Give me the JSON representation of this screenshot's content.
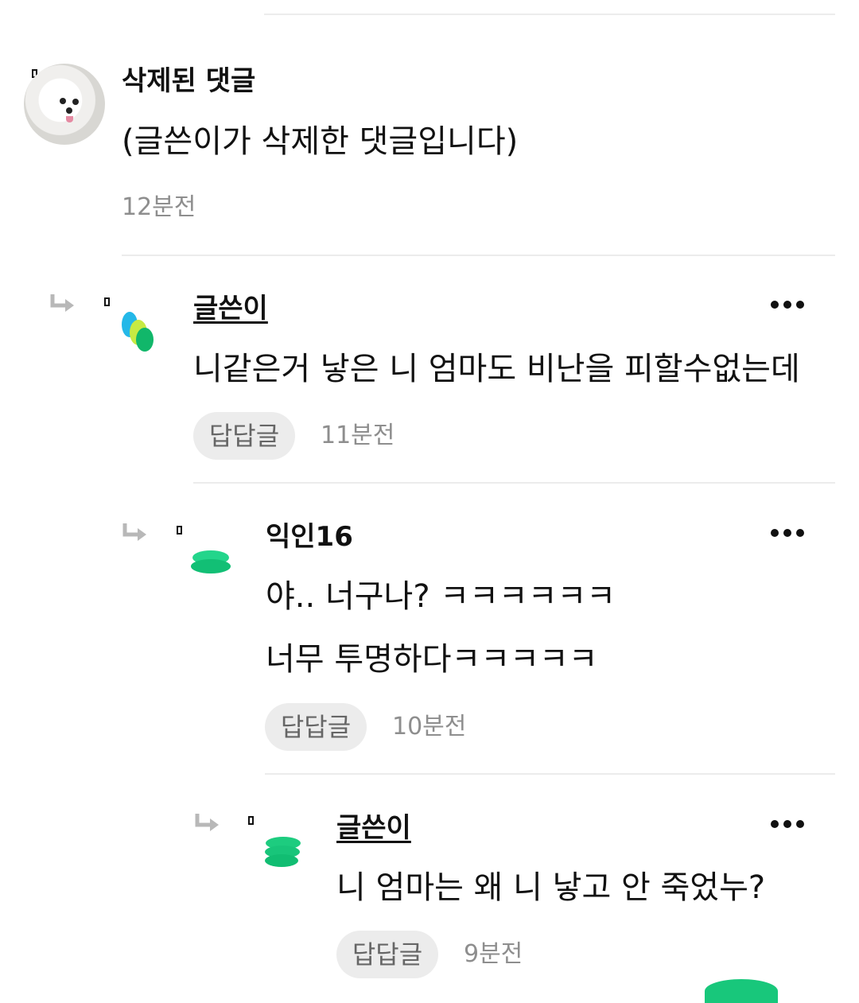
{
  "comments": [
    {
      "author": "삭제된 댓글",
      "text": "(글쓴이가 삭제한 댓글입니다)",
      "time": "12분전"
    },
    {
      "author": "글쓴이",
      "text": "니같은거 낳은 니 엄마도 비난을 피할수없는데",
      "reply_label": "답답글",
      "time": "11분전"
    },
    {
      "author": "익인16",
      "text_lines": [
        "야.. 너구나? ㅋㅋㅋㅋㅋㅋ",
        "너무 투명하다ㅋㅋㅋㅋㅋ"
      ],
      "reply_label": "답답글",
      "time": "10분전"
    },
    {
      "author": "글쓴이",
      "text": "니 엄마는 왜 니 낳고 안 죽었누?",
      "reply_label": "답답글",
      "time": "9분전"
    }
  ],
  "icons": {
    "reply_arrow": "reply-arrow-icon",
    "more": "more-options-icon"
  },
  "colors": {
    "divider": "#ececec",
    "muted_text": "#8e8e8e",
    "pill_background": "#ececec",
    "accent_green": "#18c77b"
  }
}
